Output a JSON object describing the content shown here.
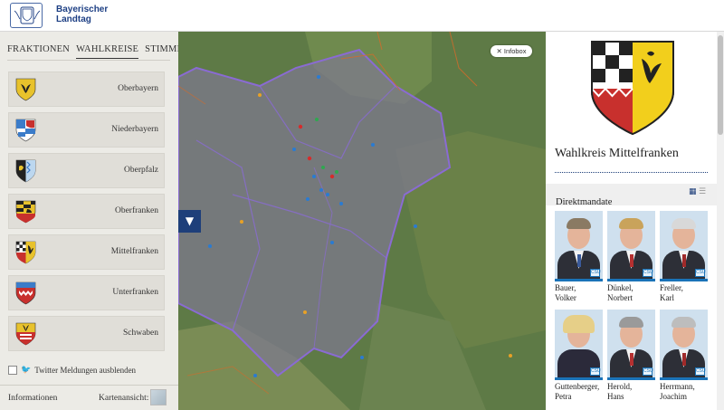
{
  "brand": {
    "name_line1": "Bayerischer",
    "name_line2": "Landtag"
  },
  "sidebar": {
    "tabs": [
      {
        "label": "FRAKTIONEN",
        "active": false
      },
      {
        "label": "WAHLKREISE",
        "active": true
      },
      {
        "label": "STIMMKREISE",
        "active": false
      }
    ],
    "wahlkreise": [
      {
        "label": "Oberbayern",
        "crest": "oberbayern-crest"
      },
      {
        "label": "Niederbayern",
        "crest": "niederbayern-crest"
      },
      {
        "label": "Oberpfalz",
        "crest": "oberpfalz-crest"
      },
      {
        "label": "Oberfranken",
        "crest": "oberfranken-crest"
      },
      {
        "label": "Mittelfranken",
        "crest": "mittelfranken-crest"
      },
      {
        "label": "Unterfranken",
        "crest": "unterfranken-crest"
      },
      {
        "label": "Schwaben",
        "crest": "schwaben-crest"
      }
    ],
    "twitter_toggle": {
      "label": "Twitter Meldungen ausblenden",
      "checked": false
    },
    "footer": {
      "info": "Informationen",
      "map_view": "Kartenansicht:"
    }
  },
  "map": {
    "infobox_label": "Infobox",
    "filter_icon": "filter-icon"
  },
  "panel": {
    "title": "Wahlkreis Mittelfranken",
    "section": "Direktmandate",
    "people": [
      {
        "last": "Bauer,",
        "first": "Volker",
        "badge": "CSU"
      },
      {
        "last": "Dünkel,",
        "first": "Norbert",
        "badge": "CSU"
      },
      {
        "last": "Freller,",
        "first": "Karl",
        "badge": "CSU"
      },
      {
        "last": "Guttenberger,",
        "first": "Petra",
        "badge": "CSU"
      },
      {
        "last": "Herold,",
        "first": "Hans",
        "badge": "CSU"
      },
      {
        "last": "Herrmann,",
        "first": "Joachim",
        "badge": "CSU"
      }
    ]
  },
  "colors": {
    "accent": "#1e3f7a",
    "party_blue": "#1a73b8",
    "sidebar_bg": "#ecebe6",
    "wk_border": "#8a6bd3"
  }
}
